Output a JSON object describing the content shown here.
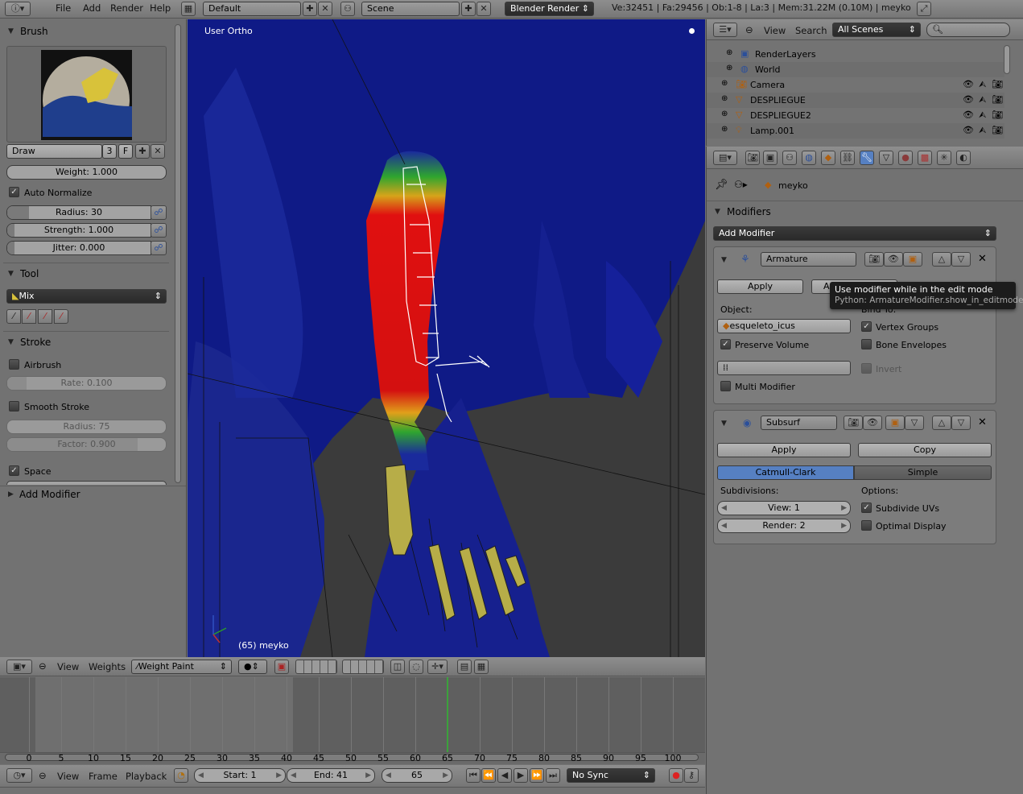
{
  "top_bar": {
    "menus": [
      "File",
      "Add",
      "Render",
      "Help"
    ],
    "screen_layout": "Default",
    "scene": "Scene",
    "engine": "Blender Render",
    "stats": "Ve:32451 | Fa:29456 | Ob:1-8 | La:3 | Mem:31.22M (0.10M) | meyko"
  },
  "tool_shelf": {
    "brush_header": "Brush",
    "brush_name": "Draw",
    "brush_users": "3",
    "brush_fake": "F",
    "weight": "Weight: 1.000",
    "weight_fraction": 1.0,
    "auto_normalize": "Auto Normalize",
    "radius": "Radius: 30",
    "radius_fraction": 0.15,
    "strength": "Strength: 1.000",
    "strength_fraction": 0.05,
    "jitter": "Jitter: 0.000",
    "jitter_fraction": 0.05,
    "tool_header": "Tool",
    "tool_mix": "Mix",
    "stroke_header": "Stroke",
    "airbrush": "Airbrush",
    "rate": "Rate: 0.100",
    "smooth_stroke": "Smooth Stroke",
    "smooth_radius": "Radius: 75",
    "smooth_factor": "Factor: 0.900",
    "factor_fraction": 0.82,
    "space": "Space",
    "add_modifier": "Add Modifier"
  },
  "viewport": {
    "view_label": "User Ortho",
    "object_label": "(65) meyko"
  },
  "outliner": {
    "menus": [
      "View",
      "Search"
    ],
    "filter": "All Scenes",
    "items": [
      {
        "name": "RenderLayers",
        "icon": "render-layers-icon"
      },
      {
        "name": "World",
        "icon": "world-icon"
      },
      {
        "name": "Camera",
        "icon": "camera-icon"
      },
      {
        "name": "DESPLIEGUE",
        "icon": "mesh-icon"
      },
      {
        "name": "DESPLIEGUE2",
        "icon": "mesh-icon"
      },
      {
        "name": "Lamp.001",
        "icon": "lamp-icon"
      }
    ]
  },
  "properties": {
    "context_object": "meyko",
    "modifiers_header": "Modifiers",
    "add_modifier": "Add Modifier",
    "armature": {
      "name": "Armature",
      "apply": "Apply",
      "apply_partial": "Apply",
      "object_label": "Object:",
      "object_value": "esqueleto_icus",
      "bind_to": "Bind To:",
      "preserve_volume": "Preserve Volume",
      "vertex_groups": "Vertex Groups",
      "bone_envelopes": "Bone Envelopes",
      "invert": "Invert",
      "multi_modifier": "Multi Modifier"
    },
    "tooltip": {
      "title": "Use modifier while in the edit mode",
      "python": "Python: ArmatureModifier.show_in_editmode"
    },
    "subsurf": {
      "name": "Subsurf",
      "apply": "Apply",
      "copy": "Copy",
      "catmull": "Catmull-Clark",
      "simple": "Simple",
      "subdivisions": "Subdivisions:",
      "options": "Options:",
      "view": "View: 1",
      "render": "Render: 2",
      "subdivide_uvs": "Subdivide UVs",
      "optimal_display": "Optimal Display"
    }
  },
  "view3d_header": {
    "menus": [
      "View",
      "Weights"
    ],
    "mode": "Weight Paint"
  },
  "timeline": {
    "ticks": [
      "0",
      "5",
      "10",
      "15",
      "20",
      "25",
      "30",
      "35",
      "40",
      "45",
      "50",
      "55",
      "60",
      "65",
      "70",
      "75",
      "80",
      "85",
      "90",
      "95",
      "100"
    ],
    "current_frame": 65,
    "menus": [
      "View",
      "Frame",
      "Playback"
    ],
    "start": "Start: 1",
    "end": "End: 41",
    "frame": "65",
    "sync": "No Sync"
  },
  "colors": {
    "accent_blue": "#5680c2",
    "playhead": "#3ca23c",
    "panel_bg": "#727272"
  }
}
